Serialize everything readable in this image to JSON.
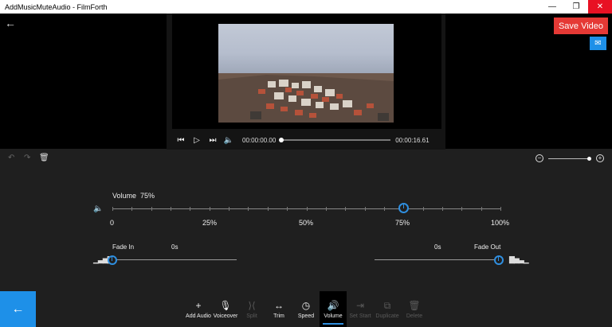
{
  "window": {
    "title": "AddMusicMuteAudio - FilmForth",
    "minimize_icon": "—",
    "maximize_icon": "❐",
    "close_icon": "✕"
  },
  "header": {
    "back_icon": "←",
    "save_label": "Save Video",
    "contact_icon": "contact-mail-icon"
  },
  "player": {
    "current_time": "00:00:00.00",
    "total_time": "00:00:16.61",
    "progress": 0.0
  },
  "timeline_toolbar": {
    "undo_icon": "↶",
    "redo_icon": "↷",
    "delete_icon": "🗑",
    "zoom_out_icon": "−",
    "zoom_in_icon": "+",
    "zoom_level": 1.0
  },
  "volume": {
    "label": "Volume",
    "value_text": "75%",
    "value": 75,
    "scale": [
      "0",
      "25%",
      "50%",
      "75%",
      "100%"
    ]
  },
  "fade": {
    "in_label": "Fade In",
    "in_value": "0s",
    "out_label": "Fade Out",
    "out_value": "0s"
  },
  "bottom_toolbar": {
    "back_icon": "←",
    "tools": [
      {
        "label": "Add Audio",
        "icon": "+",
        "state": "enabled"
      },
      {
        "label": "Voiceover",
        "icon": "🎙",
        "state": "enabled"
      },
      {
        "label": "Split",
        "icon": "⟩⟨",
        "state": "disabled"
      },
      {
        "label": "Trim",
        "icon": "↔",
        "state": "enabled"
      },
      {
        "label": "Speed",
        "icon": "◷",
        "state": "enabled"
      },
      {
        "label": "Volume",
        "icon": "🔊",
        "state": "active"
      },
      {
        "label": "Set Start",
        "icon": "⇥",
        "state": "disabled"
      },
      {
        "label": "Duplicate",
        "icon": "⧉",
        "state": "disabled"
      },
      {
        "label": "Delete",
        "icon": "🗑",
        "state": "disabled"
      }
    ]
  },
  "colors": {
    "accent": "#2f8fe0",
    "save": "#e53935",
    "background": "#1f1f1f"
  }
}
